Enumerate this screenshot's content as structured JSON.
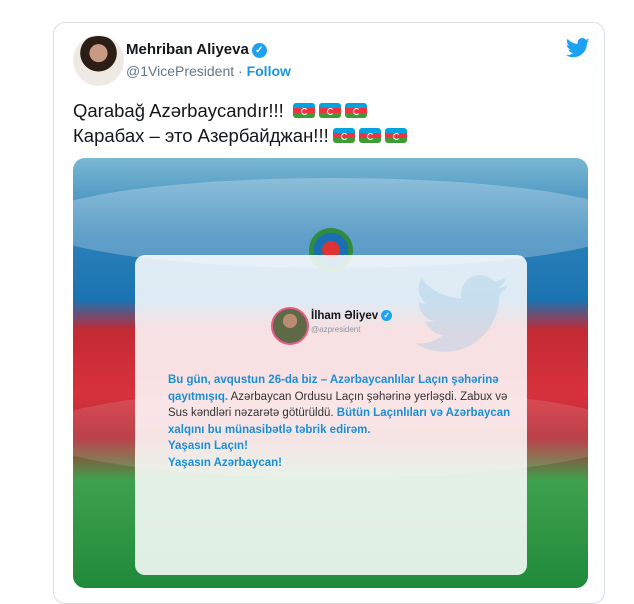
{
  "tweet": {
    "author_name": "Mehriban Aliyeva",
    "handle": "@1VicePresident",
    "separator": "·",
    "follow_label": "Follow",
    "line1": "Qarabağ Azərbaycandır!!!",
    "line2": "Карабах – это Азербайджан!!!"
  },
  "embedded": {
    "author_name": "İlham Əliyev",
    "handle": "@azpresident",
    "seg1": "Bu gün, avqustun 26-da biz – Azərbaycanlılar Laçın şəhərinə qayıtmışıq.",
    "seg2": " Azərbaycan Ordusu Laçın şəhərinə yerləşdi. Zabux və Sus kəndləri nəzarətə götürüldü. ",
    "seg3": "Bütün Laçınlıları və Azərbaycan xalqını bu münasibətlə təbrik edirəm.",
    "seg4": "Yaşasın Laçın!",
    "seg5": "Yaşasın Azərbaycan!"
  },
  "colors": {
    "accent": "#1da1f2",
    "flag_blue": "#00a3dd",
    "flag_red": "#ef3340",
    "flag_green": "#3f9c35"
  },
  "icons": [
    "twitter-bird-icon",
    "verified-badge-icon",
    "azerbaijan-flag-icon",
    "state-emblem-icon"
  ]
}
